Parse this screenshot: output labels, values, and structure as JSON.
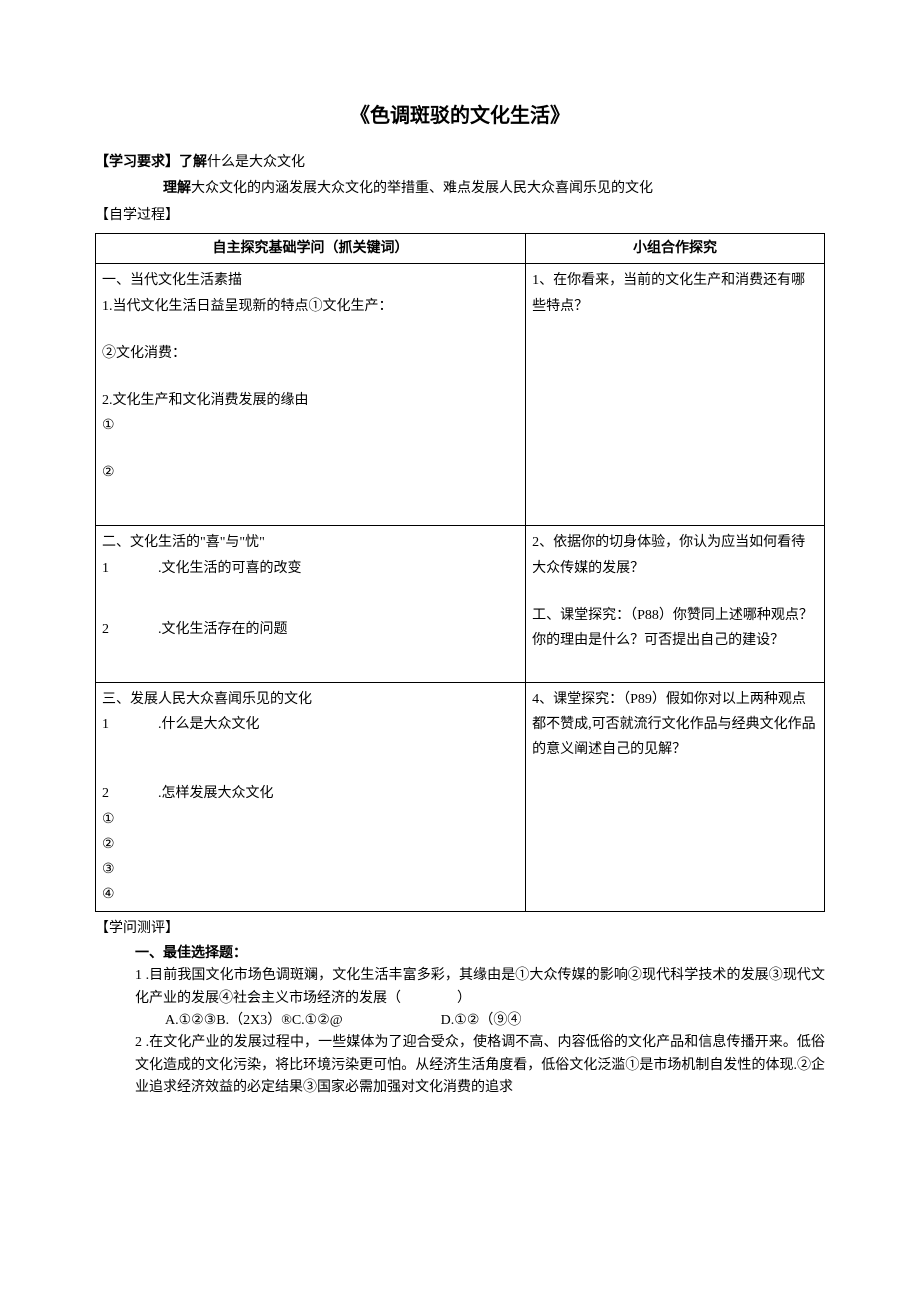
{
  "title": "《色调斑驳的文化生活》",
  "requirements": {
    "label": "【学习要求】",
    "know_label": "了解",
    "know_text": "什么是大众文化",
    "understand_label": "理解",
    "understand_text": "大众文化的内涵发展大众文化的举措重、难点发展人民大众喜闻乐见的文化"
  },
  "process_label": "【自学过程】",
  "table": {
    "head_left": "自主探究基础学问（抓关键词）",
    "head_right": "小组合作探究",
    "row1_left": {
      "l1": "一、当代文化生活素描",
      "l2": "1.当代文化生活日益呈现新的特点①文化生产：",
      "l3": "②文化消费：",
      "l4": "2.文化生产和文化消费发展的缘由",
      "l5": "①",
      "l6": "②"
    },
    "row1_right": "1、在你看来，当前的文化生产和消费还有哪些特点？",
    "row2_left": {
      "l1": "二、文化生活的\"喜\"与\"忧\"",
      "l2_num": "1",
      "l2_text": ".文化生活的可喜的改变",
      "l3_num": "2",
      "l3_text": ".文化生活存在的问题"
    },
    "row2_right": {
      "p1": "2、依据你的切身体验，你认为应当如何看待大众传媒的发展？",
      "p2": "工、课堂探究：（P88）你赞同上述哪种观点？你的理由是什么？可否提出自己的建设？"
    },
    "row3_left": {
      "l1": "三、发展人民大众喜闻乐见的文化",
      "l2_num": "1",
      "l2_text": ".什么是大众文化",
      "l3_num": "2",
      "l3_text": ".怎样发展大众文化",
      "c1": "①",
      "c2": "②",
      "c3": "③",
      "c4": "④"
    },
    "row3_right": "4、课堂探究：（P89）假如你对以上两种观点都不赞成,可否就流行文化作品与经典文化作品的意义阐述自己的见解？"
  },
  "evaluation": {
    "label": "【学问测评】",
    "heading": "一、最佳选择题：",
    "q1": "1 .目前我国文化市场色调斑斓，文化生活丰富多彩，其缘由是①大众传媒的影响②现代科学技术的发展③现代文化产业的发展④社会主义市场经济的发展（　　　　）",
    "q1_options": "A.①②③B.（2X3）®C.①②@　　　　　　　D.①②（⑨④",
    "q2": "2 .在文化产业的发展过程中，一些媒体为了迎合受众，使格调不高、内容低俗的文化产品和信息传播开来。低俗文化造成的文化污染，将比环境污染更可怕。从经济生活角度看，低俗文化泛滥①是市场机制自发性的体现.②企业追求经济效益的必定结果③国家必需加强对文化消费的追求"
  }
}
